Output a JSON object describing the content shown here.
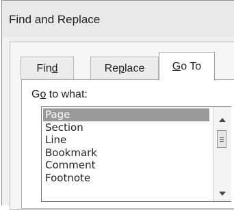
{
  "dialog": {
    "title": "Find and Replace"
  },
  "tabs": [
    {
      "pre": "Fin",
      "key": "d",
      "post": ""
    },
    {
      "pre": "Re",
      "key": "p",
      "post": "lace"
    },
    {
      "pre": "",
      "key": "G",
      "post": "o To",
      "active": true
    }
  ],
  "goto": {
    "label_pre": "G",
    "label_key": "o",
    "label_post": " to what:",
    "items": [
      "Page",
      "Section",
      "Line",
      "Bookmark",
      "Comment",
      "Footnote"
    ],
    "selected": "Page"
  },
  "icons": {
    "scroll_up": "arrow-up-icon",
    "scroll_down": "arrow-down-icon"
  }
}
